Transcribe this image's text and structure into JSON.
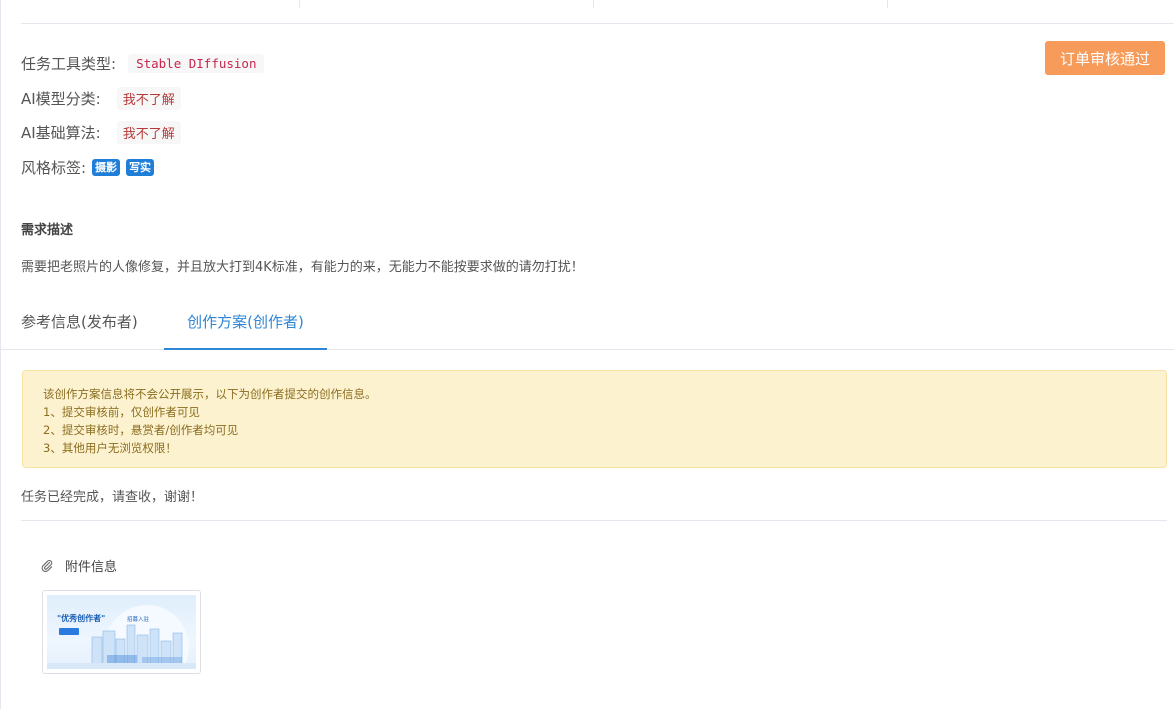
{
  "header": {
    "approve_button": "订单审核通过"
  },
  "meta": {
    "tool_type_label": "任务工具类型:",
    "tool_type_value": "Stable DIffusion",
    "model_category_label": "AI模型分类:",
    "model_category_value": "我不了解",
    "algorithm_label": "AI基础算法:",
    "algorithm_value": "我不了解",
    "style_tags_label": "风格标签:",
    "style_tags": [
      "摄影",
      "写实"
    ]
  },
  "requirement": {
    "title": "需求描述",
    "text": "需要把老照片的人像修复，并且放大打到4K标准，有能力的来，无能力不能按要求做的请勿打扰！"
  },
  "tabs": [
    {
      "label": "参考信息(发布者)",
      "active": false
    },
    {
      "label": "创作方案(创作者)",
      "active": true
    }
  ],
  "notice": {
    "lines": [
      "该创作方案信息将不会公开展示，以下为创作者提交的创作信息。",
      "1、提交审核前，仅创作者可见",
      "2、提交审核时，悬赏者/创作者均可见",
      "3、其他用户无浏览权限！"
    ]
  },
  "submission_text": "任务已经完成，请查收，谢谢！",
  "attachment": {
    "title": "附件信息",
    "icon": "paperclip-icon",
    "thumbnail_title": "\"优秀创作者\"",
    "thumbnail_sub": "招募入驻"
  },
  "colors": {
    "accent": "#2f86d6",
    "approve": "#f79b5a",
    "tag_blue": "#1e7ed8",
    "notice_bg": "#fdf2cf"
  }
}
